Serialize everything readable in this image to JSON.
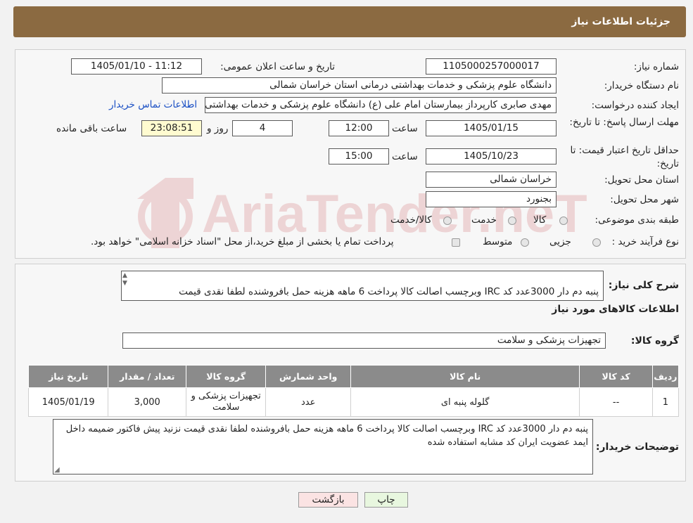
{
  "header": {
    "title": "جزئیات اطلاعات نیاز"
  },
  "form": {
    "need_number_label": "شماره نیاز:",
    "need_number": "1105000257000017",
    "announce_label": "تاریخ و ساعت اعلان عمومی:",
    "announce_value": "1405/01/10 - 11:12",
    "buyer_org_label": "نام دستگاه خریدار:",
    "buyer_org": "دانشگاه علوم پزشکی و خدمات بهداشتی درمانی استان خراسان شمالی",
    "requester_label": "ایجاد کننده درخواست:",
    "requester": "مهدی صابری کارپرداز بیمارستان امام علی (ع) دانشگاه علوم پزشکی و خدمات بهداشتی",
    "contact_link": "اطلاعات تماس خریدار",
    "deadline_label": "مهلت ارسال پاسخ: تا تاریخ:",
    "deadline_date": "1405/01/15",
    "time_label": "ساعت",
    "deadline_time": "12:00",
    "days_value": "4",
    "days_label": "روز و",
    "remaining_time": "23:08:51",
    "remaining_label": "ساعت باقی مانده",
    "validity_label": "حداقل تاریخ اعتبار قیمت: تا تاریخ:",
    "validity_date": "1405/10/23",
    "validity_time": "15:00",
    "province_label": "استان محل تحویل:",
    "province": "خراسان شمالی",
    "city_label": "شهر محل تحویل:",
    "city": "بجنورد",
    "category_label": "طبقه بندی موضوعی:",
    "category_options": [
      "کالا",
      "خدمت",
      "کالا/خدمت"
    ],
    "process_label": "نوع فرآیند خرید :",
    "process_options": [
      "جزیی",
      "متوسط"
    ],
    "process_note": "پرداخت تمام یا بخشی از مبلغ خرید،از محل \"اسناد خزانه اسلامی\" خواهد بود."
  },
  "details": {
    "summary_label": "شرح کلی نیاز:",
    "summary_text": "پنبه دم دار 3000عدد  کد IRC وبرچسب اصالت کالا پرداخت 6 ماهه هزینه حمل بافروشنده لطفا نقدی قیمت",
    "items_title": "اطلاعات کالاهای مورد نیاز",
    "goods_group_label": "گروه کالا:",
    "goods_group": "تجهیزات پزشکی و سلامت"
  },
  "table": {
    "headers": [
      "ردیف",
      "کد کالا",
      "نام کالا",
      "واحد شمارش",
      "گروه کالا",
      "تعداد / مقدار",
      "تاریخ نیاز"
    ],
    "rows": [
      [
        "1",
        "--",
        "گلوله پنبه ای",
        "عدد",
        "تجهیزات پزشکی و سلامت",
        "3,000",
        "1405/01/19"
      ]
    ]
  },
  "buyer_notes": {
    "label": "توضیحات خریدار:",
    "text": "پنبه دم دار 3000عدد  کد IRC وبرچسب اصالت کالا پرداخت 6 ماهه هزینه حمل بافروشنده لطفا نقدی قیمت نزنید پیش فاکتور ضمیمه داخل ایمد عضویت ایران کد مشابه استفاده شده"
  },
  "buttons": {
    "print": "چاپ",
    "back": "بازگشت"
  },
  "watermark": {
    "text": "AriaTender.neT"
  },
  "colors": {
    "header": "#8b6a41",
    "table_header": "#8b8b8b",
    "link": "#1a4fc4",
    "back_button": "#fbe3e3",
    "print_button": "#e8f7df"
  }
}
